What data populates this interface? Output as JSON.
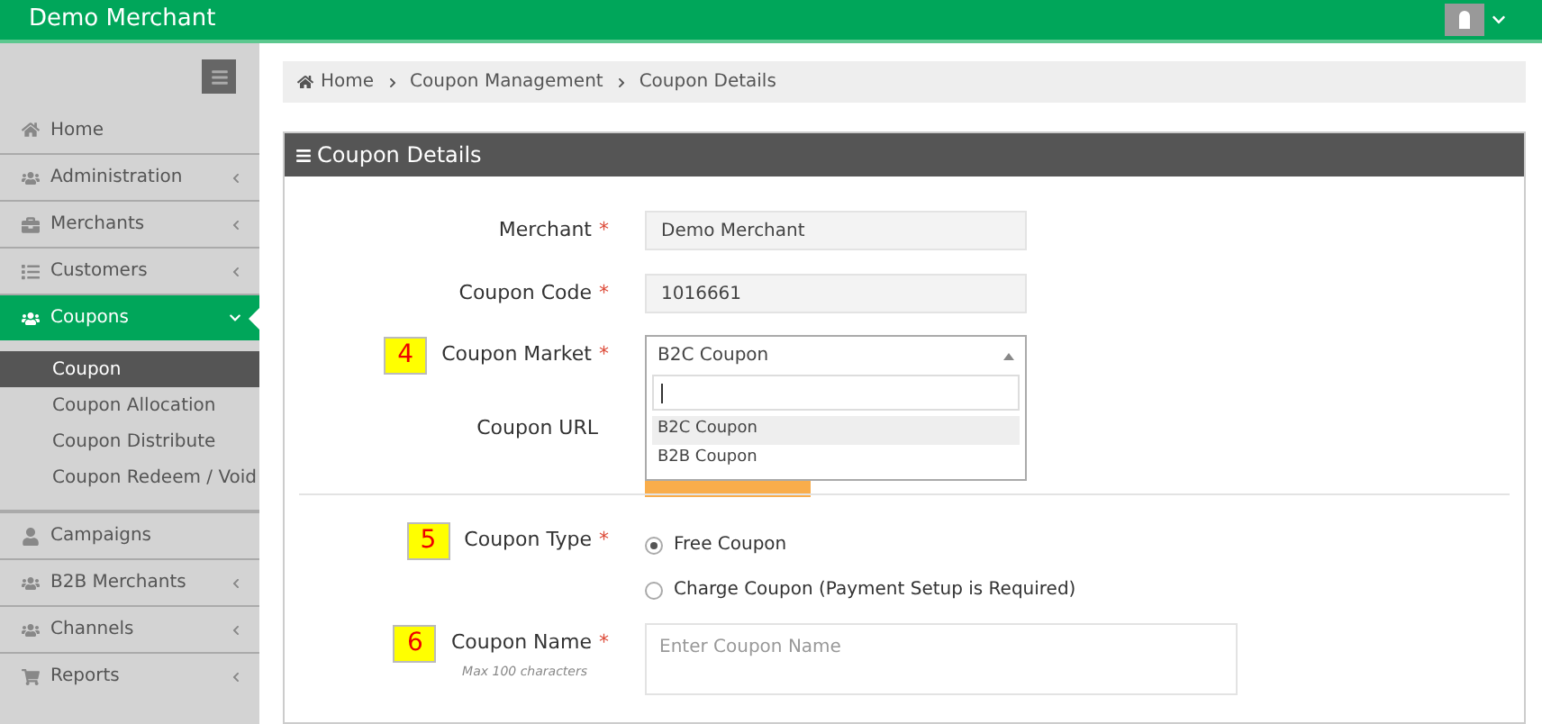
{
  "header": {
    "title": "Demo Merchant"
  },
  "sidebar": {
    "items": [
      {
        "label": "Home",
        "selected": false
      },
      {
        "label": "Administration",
        "selected": false,
        "expanded": false
      },
      {
        "label": "Merchants",
        "selected": false,
        "expanded": false
      },
      {
        "label": "Customers",
        "selected": false,
        "expanded": false
      },
      {
        "label": "Coupons",
        "selected": true,
        "expanded": true,
        "children": [
          {
            "label": "Coupon",
            "selected": true
          },
          {
            "label": "Coupon Allocation",
            "selected": false
          },
          {
            "label": "Coupon Distribute",
            "selected": false
          },
          {
            "label": "Coupon Redeem / Void",
            "selected": false
          }
        ]
      },
      {
        "label": "Campaigns",
        "selected": false
      },
      {
        "label": "B2B Merchants",
        "selected": false,
        "expanded": false
      },
      {
        "label": "Channels",
        "selected": false,
        "expanded": false
      },
      {
        "label": "Reports",
        "selected": false,
        "expanded": false
      }
    ]
  },
  "breadcrumb": [
    "Home",
    "Coupon Management",
    "Coupon Details"
  ],
  "panel": {
    "title": "Coupon Details",
    "merchant": {
      "label": "Merchant",
      "required_mark": "*",
      "value": "Demo Merchant"
    },
    "coupon_code": {
      "label": "Coupon Code",
      "required_mark": "*",
      "value": "1016661"
    },
    "coupon_market": {
      "badge": "4",
      "label": "Coupon Market",
      "required_mark": "*",
      "value": "B2C Coupon",
      "options": [
        {
          "label": "B2C Coupon",
          "selected": true
        },
        {
          "label": "B2B Coupon",
          "selected": false
        }
      ]
    },
    "coupon_url": {
      "label": "Coupon URL"
    },
    "coupon_type": {
      "badge": "5",
      "label": "Coupon Type",
      "required_mark": "*",
      "options": [
        {
          "label": "Free Coupon",
          "selected": true
        },
        {
          "label": "Charge Coupon (Payment Setup is Required)",
          "selected": false
        }
      ]
    },
    "coupon_name": {
      "badge": "6",
      "label": "Coupon Name",
      "required_mark": "*",
      "hint": "Max 100 characters",
      "placeholder": "Enter Coupon Name"
    }
  }
}
